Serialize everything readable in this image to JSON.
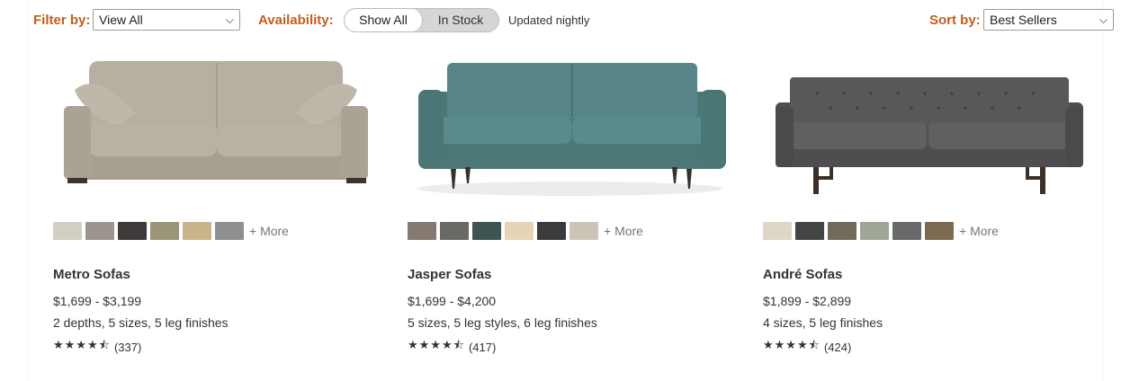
{
  "filters": {
    "filter_by_label": "Filter by:",
    "filter_value": "View All",
    "availability_label": "Availability:",
    "availability_options": [
      "Show All",
      "In Stock"
    ],
    "availability_selected": "Show All",
    "updated_note": "Updated nightly",
    "sort_by_label": "Sort by:",
    "sort_value": "Best Sellers"
  },
  "colors": {
    "accent_orange": "#c25e1e",
    "toggle_off_bg": "#d6d6d6"
  },
  "products": [
    {
      "name": "Metro Sofas",
      "price": "$1,699 - $3,199",
      "detail": "2 depths, 5 sizes, 5 leg finishes",
      "stars": "★★★★⯪",
      "rating_value": 4.5,
      "reviews": "(337)",
      "more_label": "+ More",
      "sofa_color": "#b1aa9b",
      "swatches": [
        "#d3cfc4",
        "#9b948f",
        "#3d3a39",
        "#9a9479",
        "#c9b48c",
        "#8e8f90"
      ]
    },
    {
      "name": "Jasper Sofas",
      "price": "$1,699 - $4,200",
      "detail": "5 sizes, 5 leg styles, 6 leg finishes",
      "stars": "★★★★⯪",
      "rating_value": 4.5,
      "reviews": "(417)",
      "more_label": "+ More",
      "sofa_color": "#4f7e7d",
      "swatches": [
        "#847a72",
        "#6a6965",
        "#3c5452",
        "#e6d5b4",
        "#3b3b3d",
        "#cbc5b8"
      ]
    },
    {
      "name": "André Sofas",
      "price": "$1,899 - $2,899",
      "detail": "4 sizes, 5 leg finishes",
      "stars": "★★★★⯪",
      "rating_value": 4.5,
      "reviews": "(424)",
      "more_label": "+ More",
      "sofa_color": "#5b5b5d",
      "swatches": [
        "#ded7c8",
        "#444446",
        "#6f6a5c",
        "#9ea796",
        "#67696b",
        "#7d6a52"
      ]
    }
  ]
}
